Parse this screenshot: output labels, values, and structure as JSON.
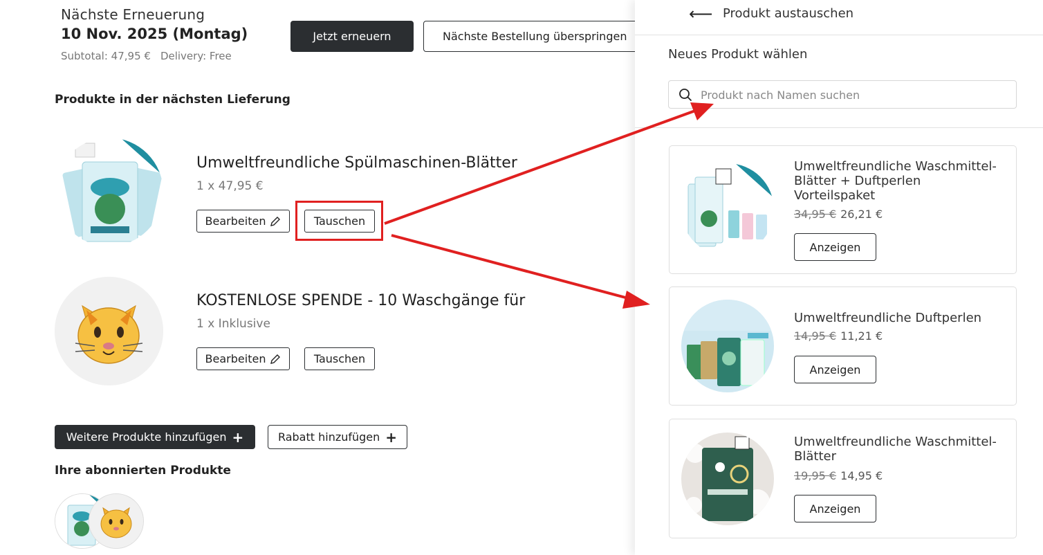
{
  "renewal": {
    "label": "Nächste Erneuerung",
    "date": "10 Nov. 2025 (Montag)",
    "subtotal": "Subtotal: 47,95 €",
    "delivery": "Delivery: Free",
    "renew_label": "Jetzt erneuern",
    "skip_label": "Nächste Bestellung überspringen"
  },
  "delivery_section": {
    "title": "Produkte in der nächsten Lieferung",
    "products": [
      {
        "title": "Umweltfreundliche Spülmaschinen-Blätter",
        "qty": "1 x 47,95 €",
        "edit_label": "Bearbeiten",
        "swap_label": "Tauschen",
        "image_icon": "dishwasher-sheets-package"
      },
      {
        "title": "KOSTENLOSE SPENDE - 10 Waschgänge für",
        "qty": "1 x Inklusive",
        "edit_label": "Bearbeiten",
        "swap_label": "Tauschen",
        "image_icon": "cat-face-emoji"
      }
    ]
  },
  "actions": {
    "add_products": "Weitere Produkte hinzufügen",
    "add_discount": "Rabatt hinzufügen"
  },
  "subscribed": {
    "title": "Ihre abonnierten Produkte"
  },
  "drawer": {
    "title": "Produkt austauschen",
    "choose_label": "Neues Produkt wählen",
    "search_placeholder": "Produkt nach Namen suchen",
    "cards": [
      {
        "title": "Umweltfreundliche Waschmittel-Blätter + Duftperlen Vorteilspaket",
        "old_price": "34,95 €",
        "new_price": "26,21 €",
        "button": "Anzeigen"
      },
      {
        "title": "Umweltfreundliche Duftperlen",
        "old_price": "14,95 €",
        "new_price": "11,21 €",
        "button": "Anzeigen"
      },
      {
        "title": "Umweltfreundliche Waschmittel-Blätter",
        "old_price": "19,95 €",
        "new_price": "14,95 €",
        "button": "Anzeigen"
      }
    ]
  },
  "colors": {
    "dark_button": "#2b2e31",
    "annotation_red": "#e02020",
    "brand_teal": "#2a8fa0"
  }
}
